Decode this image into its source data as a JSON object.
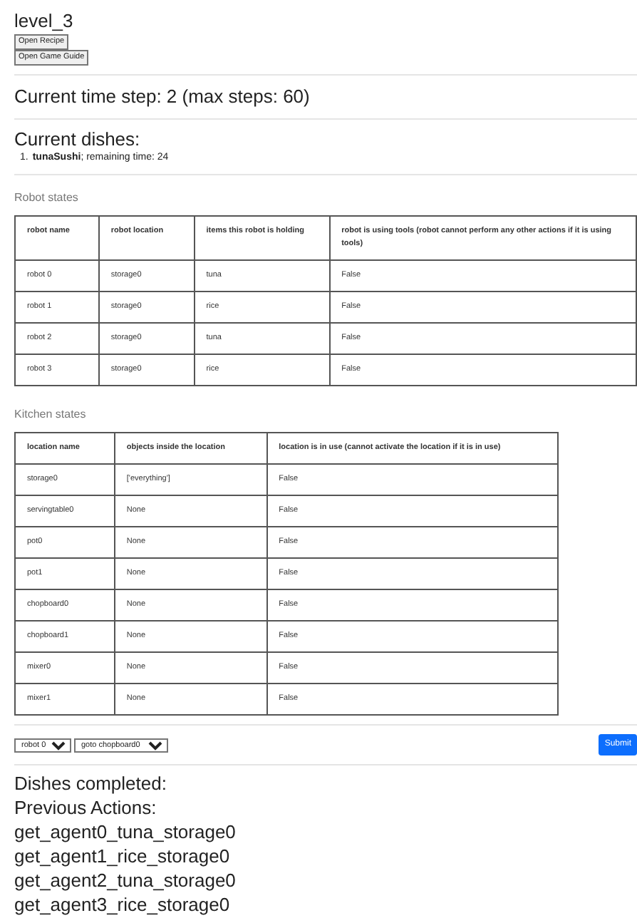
{
  "level_title": "level_3",
  "buttons": [
    "Open Recipe",
    "Open Game Guide"
  ],
  "time_step": "Current time step: 2 (max steps: 60)",
  "current_dishes": {
    "title": "Current dishes:",
    "items": [
      {
        "number": "1.",
        "text": "**tunaSushi**; remaining time: 24"
      }
    ]
  },
  "robot_states": {
    "title": "Robot states",
    "columns": [
      "robot name",
      "robot location",
      "items this robot is holding",
      "robot is using tools (robot cannot perform any other actions if it is using tools)"
    ],
    "rows": [
      [
        "robot 0",
        "storage0",
        "tuna",
        "False"
      ],
      [
        "robot 1",
        "storage0",
        "rice",
        "False"
      ],
      [
        "robot 2",
        "storage0",
        "tuna",
        "False"
      ],
      [
        "robot 3",
        "storage0",
        "rice",
        "False"
      ]
    ]
  },
  "kitchen_states": {
    "title": "Kitchen states",
    "columns": [
      "location name",
      "objects inside the location",
      "location is in use (cannot activate the location if it is in use)"
    ],
    "rows": [
      [
        "storage0",
        "['everything']",
        "False"
      ],
      [
        "servingtable0",
        "None",
        "False"
      ],
      [
        "pot0",
        "None",
        "False"
      ],
      [
        "pot1",
        "None",
        "False"
      ],
      [
        "chopboard0",
        "None",
        "False"
      ],
      [
        "chopboard1",
        "None",
        "False"
      ],
      [
        "mixer0",
        "None",
        "False"
      ],
      [
        "mixer1",
        "None",
        "False"
      ]
    ]
  },
  "action_form": {
    "robot_select": "robot 0",
    "action_select": "goto chopboard0",
    "submit": "Submit"
  },
  "dishes_completed": "Dishes completed:",
  "previous_actions": {
    "title": "Previous Actions:",
    "items": [
      "get_agent0_tuna_storage0",
      "get_agent1_rice_storage0",
      "get_agent2_tuna_storage0",
      "get_agent3_rice_storage0"
    ]
  }
}
